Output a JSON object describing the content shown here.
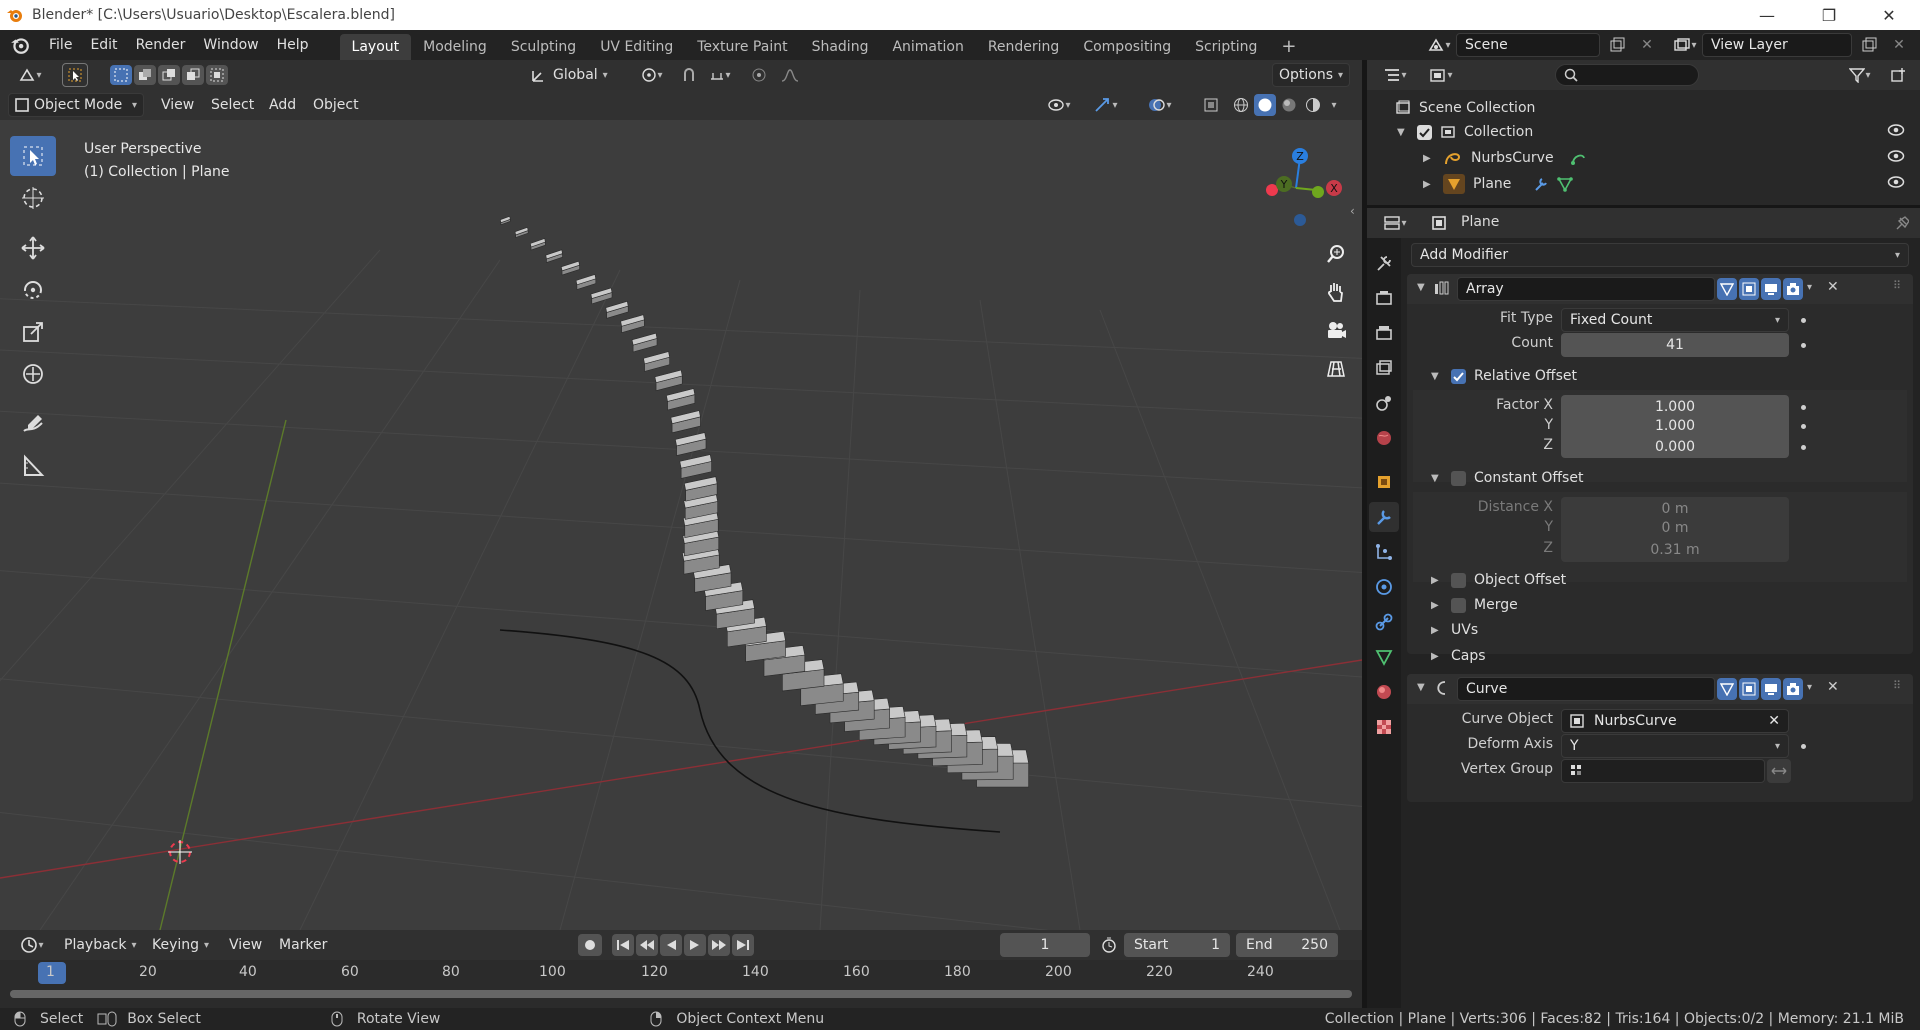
{
  "window": {
    "title": "Blender* [C:\\Users\\Usuario\\Desktop\\Escalera.blend]",
    "minimize": "—",
    "maximize": "❐",
    "close": "✕"
  },
  "menu": [
    "File",
    "Edit",
    "Render",
    "Window",
    "Help"
  ],
  "workspaces": [
    "Layout",
    "Modeling",
    "Sculpting",
    "UV Editing",
    "Texture Paint",
    "Shading",
    "Animation",
    "Rendering",
    "Compositing",
    "Scripting"
  ],
  "active_workspace": "Layout",
  "scene": {
    "name": "Scene",
    "view_layer": "View Layer"
  },
  "viewport_header": {
    "transform_orientation": "Global",
    "options": "Options",
    "mode": "Object Mode",
    "menus": [
      "View",
      "Select",
      "Add",
      "Object"
    ]
  },
  "viewport": {
    "perspective": "User Perspective",
    "context": "(1) Collection | Plane",
    "gizmo_axes": {
      "x": "X",
      "y": "Y",
      "z": "Z"
    }
  },
  "outliner": {
    "search_placeholder": "",
    "root": "Scene Collection",
    "collection": "Collection",
    "items": [
      {
        "name": "NurbsCurve",
        "icon": "curve-icon"
      },
      {
        "name": "Plane",
        "icon": "mesh-icon"
      }
    ]
  },
  "properties": {
    "object_name": "Plane",
    "add_modifier": "Add Modifier",
    "array": {
      "name": "Array",
      "fit_type_label": "Fit Type",
      "fit_type": "Fixed Count",
      "count_label": "Count",
      "count": "41",
      "relative_offset": "Relative Offset",
      "factor_x_label": "Factor X",
      "factor_x": "1.000",
      "y_label": "Y",
      "factor_y": "1.000",
      "z_label": "Z",
      "factor_z": "0.000",
      "constant_offset": "Constant Offset",
      "distance_x_label": "Distance X",
      "distance_x": "0 m",
      "dist_y_label": "Y",
      "distance_y": "0 m",
      "dist_z_label": "Z",
      "distance_z": "0.31 m",
      "object_offset": "Object Offset",
      "merge": "Merge",
      "uvs": "UVs",
      "caps": "Caps"
    },
    "curve": {
      "name": "Curve",
      "curve_object_label": "Curve Object",
      "curve_object": "NurbsCurve",
      "deform_axis_label": "Deform Axis",
      "deform_axis": "Y",
      "vertex_group_label": "Vertex Group",
      "vertex_group": ""
    }
  },
  "timeline": {
    "menus": [
      "Playback",
      "Keying",
      "View",
      "Marker"
    ],
    "current_frame": "1",
    "start_label": "Start",
    "start": "1",
    "end_label": "End",
    "end": "250",
    "ruler": [
      "1",
      "20",
      "40",
      "60",
      "80",
      "100",
      "120",
      "140",
      "160",
      "180",
      "200",
      "220",
      "240"
    ]
  },
  "statusbar": {
    "select": "Select",
    "box_select": "Box Select",
    "rotate_view": "Rotate View",
    "context_menu": "Object Context Menu",
    "stats": "Collection | Plane | Verts:306 | Faces:82 | Tris:164 | Objects:0/2 | Memory: 21.1 MiB"
  },
  "colors": {
    "accent": "#4772b3",
    "x_axis": "#ee3a4e",
    "y_axis": "#6fa71e",
    "z_axis": "#2a7fe0"
  }
}
